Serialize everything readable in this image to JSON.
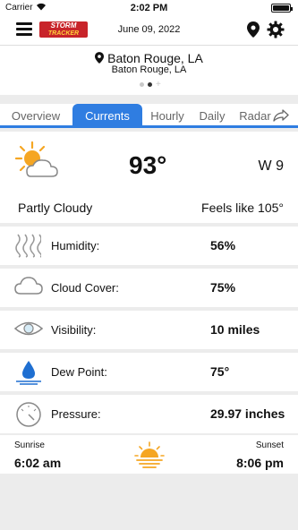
{
  "status_bar": {
    "carrier": "Carrier",
    "time": "2:02 PM"
  },
  "header": {
    "logo_line1": "STORM",
    "logo_line2": "TRACKER",
    "date": "June 09, 2022"
  },
  "location": {
    "primary": "Baton Rouge, LA",
    "secondary": "Baton Rouge, LA"
  },
  "tabs": [
    {
      "label": "Overview"
    },
    {
      "label": "Currents"
    },
    {
      "label": "Hourly"
    },
    {
      "label": "Daily"
    },
    {
      "label": "Radar"
    }
  ],
  "current": {
    "temperature": "93°",
    "wind": "W 9",
    "condition": "Partly Cloudy",
    "feels_like": "Feels like 105°"
  },
  "details": [
    {
      "label": "Humidity:",
      "value": "56%"
    },
    {
      "label": "Cloud Cover:",
      "value": "75%"
    },
    {
      "label": "Visibility:",
      "value": "10 miles"
    },
    {
      "label": "Dew Point:",
      "value": "75°"
    },
    {
      "label": "Pressure:",
      "value": "29.97 inches"
    }
  ],
  "sun": {
    "sunrise_label": "Sunrise",
    "sunrise_time": "6:02 am",
    "sunset_label": "Sunset",
    "sunset_time": "8:06 pm"
  },
  "colors": {
    "accent": "#2f7de1",
    "sun": "#f5a623"
  }
}
